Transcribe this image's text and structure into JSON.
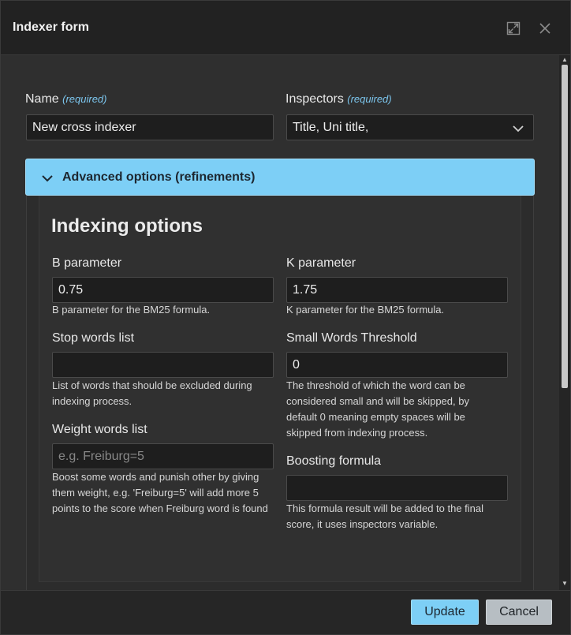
{
  "window": {
    "title": "Indexer form",
    "maximize_icon": "maximize-icon",
    "close_icon": "close-icon"
  },
  "form": {
    "name": {
      "label": "Name",
      "required": "(required)",
      "value": "New cross indexer"
    },
    "inspectors": {
      "label": "Inspectors",
      "required": "(required)",
      "value": "Title, Uni title,"
    }
  },
  "advanced": {
    "header": "Advanced options (refinements)",
    "section_title": "Indexing options",
    "b_parameter": {
      "label": "B parameter",
      "value": "0.75",
      "help": "B parameter for the BM25 formula."
    },
    "k_parameter": {
      "label": "K parameter",
      "value": "1.75",
      "help": "K parameter for the BM25 formula."
    },
    "stop_words": {
      "label": "Stop words list",
      "value": "",
      "help_lines": [
        "List of words that should be excluded during",
        "indexing process."
      ]
    },
    "small_words": {
      "label": "Small Words Threshold",
      "value": "0",
      "help_lines": [
        "The threshold of which the word can be",
        "considered small and will be skipped, by",
        "default 0 meaning empty spaces will be",
        "skipped from indexing process."
      ]
    },
    "weight_words": {
      "label": "Weight words list",
      "placeholder": "e.g. Freiburg=5",
      "help_lines": [
        "Boost some words and punish other by giving",
        "them weight, e.g. 'Freiburg=5' will add more 5",
        "points to the score when Freiburg word is found"
      ]
    },
    "boosting": {
      "label": "Boosting formula",
      "value": "",
      "help_lines": [
        "This formula result will be added to the final",
        "score, it uses inspectors variable."
      ]
    }
  },
  "footer": {
    "update_label": "Update",
    "cancel_label": "Cancel"
  },
  "colors": {
    "accent": "#7dcff6",
    "required": "#7cc6ee",
    "background": "#2f2f2f"
  }
}
